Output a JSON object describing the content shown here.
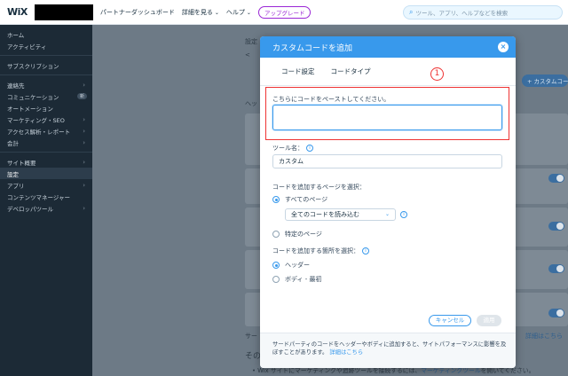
{
  "topbar": {
    "logo": "WiX",
    "nav": [
      "パートナーダッシュボード",
      "詳細を見る",
      "ヘルプ"
    ],
    "upgrade": "アップグレード",
    "search_placeholder": "ツール、アプリ、ヘルプなどを検索"
  },
  "sidebar": {
    "items": [
      {
        "label": "ホーム"
      },
      {
        "label": "アクティビティ"
      },
      {
        "label": "サブスクリプション"
      },
      {
        "label": "連絡先"
      },
      {
        "label": "コミュニケーション"
      },
      {
        "label": "オートメーション"
      },
      {
        "label": "マーケティング・SEO"
      },
      {
        "label": "アクセス解析・レポート"
      },
      {
        "label": "会計"
      },
      {
        "label": "サイト概要"
      },
      {
        "label": "設定"
      },
      {
        "label": "アプリ"
      },
      {
        "label": "コンテンツマネージャー"
      },
      {
        "label": "デベロッパツール"
      }
    ],
    "badge": "新"
  },
  "main": {
    "crumb": "設定",
    "back": "<",
    "header_label": "ヘッ",
    "add_button": "+ カスタムコード",
    "footer_side": "サー",
    "footer_side2": "その",
    "link_right": "詳細はこちら",
    "bottom_text": "Wix サイトにマーケティングや追跡ツールを接続するには、",
    "bottom_link": "マーケティングツール",
    "bottom_text2": "を開いてください。"
  },
  "modal": {
    "title": "カスタムコードを追加",
    "tabs": [
      "コード設定",
      "コードタイプ"
    ],
    "annotation": "1",
    "paste_label": "こちらにコードをペーストしてください。",
    "tool_name_label": "ツール名：",
    "tool_name_value": "カスタム",
    "pages_label": "コードを追加するページを選択：",
    "all_pages": "すべてのページ",
    "load_option": "全てのコードを読み込む",
    "specific_page": "特定のページ",
    "place_label": "コードを追加する箇所を選択：",
    "header": "ヘッダー",
    "body_first": "ボディ - 最初",
    "cancel": "キャンセル",
    "apply": "適用",
    "footer_text": "サードパーティのコードをヘッダーやボディに追加すると、サイトパフォーマンスに影響を及ぼすことがあります。",
    "footer_link": "詳細はこちら"
  }
}
